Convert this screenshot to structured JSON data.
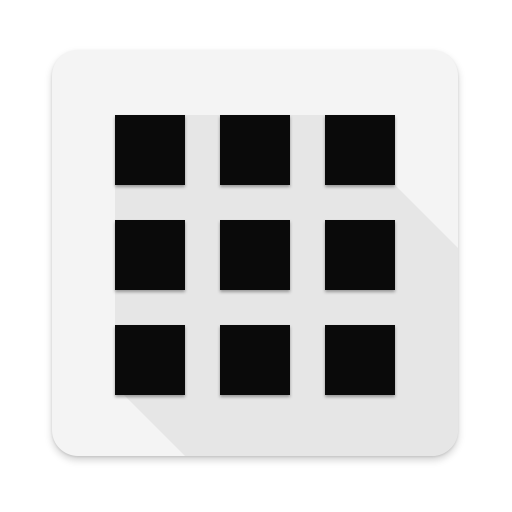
{
  "icon": {
    "name": "app-grid-icon",
    "background_color": "#f4f4f4",
    "tile_color": "#0a0a0a",
    "shadow_color": "#e2e2e2",
    "tiles": [
      {
        "name": "grid-tile-1"
      },
      {
        "name": "grid-tile-2"
      },
      {
        "name": "grid-tile-3"
      },
      {
        "name": "grid-tile-4"
      },
      {
        "name": "grid-tile-5"
      },
      {
        "name": "grid-tile-6"
      },
      {
        "name": "grid-tile-7"
      },
      {
        "name": "grid-tile-8"
      },
      {
        "name": "grid-tile-9"
      }
    ]
  }
}
